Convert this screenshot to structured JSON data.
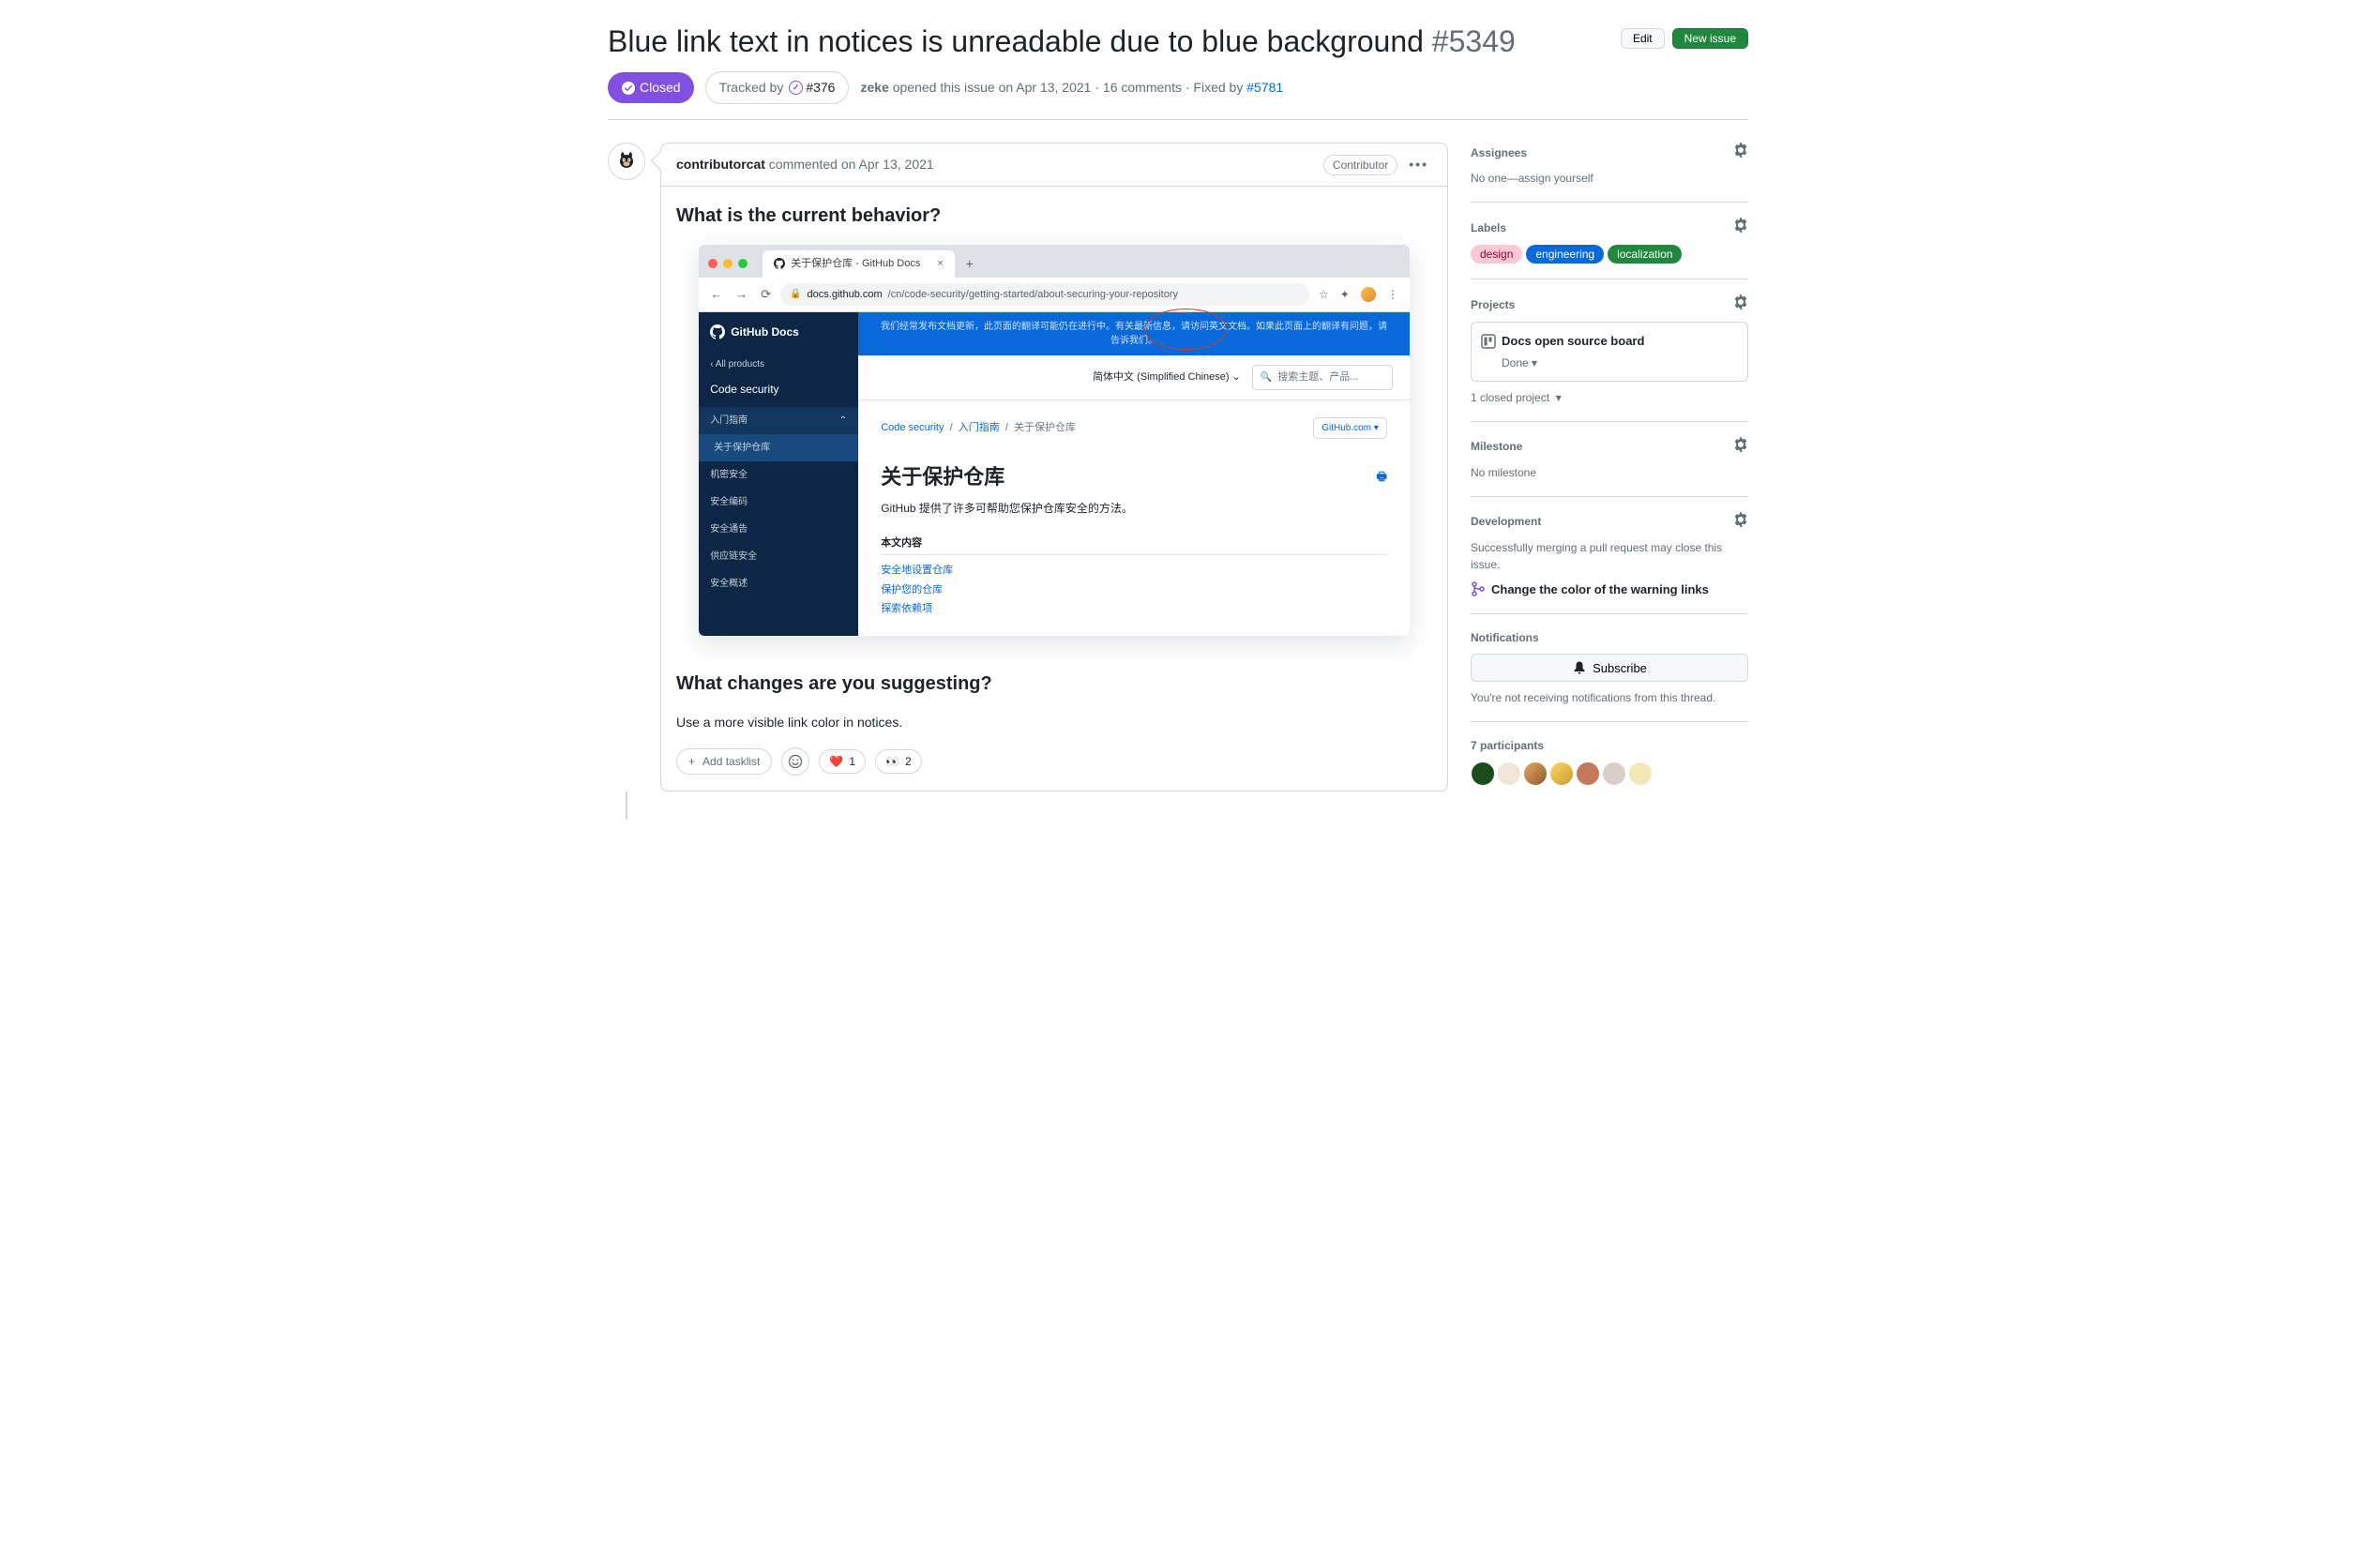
{
  "header": {
    "title": "Blue link text in notices is unreadable due to blue background",
    "issue_number": "#5349",
    "edit_label": "Edit",
    "new_issue_label": "New issue",
    "state_label": "Closed",
    "tracked_by_label": "Tracked by",
    "tracked_ref": "#376",
    "author": "zeke",
    "opened_text": " opened this issue ",
    "opened_date": "on Apr 13, 2021",
    "comments_sep": " · ",
    "comments_count": "16 comments",
    "fixed_by_sep": " · Fixed by ",
    "fixed_by_ref": "#5781"
  },
  "comment": {
    "author": "contributorcat",
    "commented_text": " commented ",
    "date": "on Apr 13, 2021",
    "badge": "Contributor",
    "h3_1": "What is the current behavior?",
    "h3_2": "What changes are you suggesting?",
    "body_2": "Use a more visible link color in notices.",
    "tasklist_label": "Add tasklist",
    "reactions": [
      {
        "emoji": "❤️",
        "count": "1"
      },
      {
        "emoji": "👀",
        "count": "2"
      }
    ]
  },
  "screenshot": {
    "tab_title": "关于保护仓库 - GitHub Docs",
    "url_domain": "docs.github.com",
    "url_path": "/cn/code-security/getting-started/about-securing-your-repository",
    "brand": "GitHub Docs",
    "back_all": "All products",
    "section": "Code security",
    "nav_items": [
      "入门指南",
      "关于保护仓库",
      "机密安全",
      "安全编码",
      "安全通告",
      "供应链安全",
      "安全概述"
    ],
    "banner": "我们经常发布文档更新，此页面的翻译可能仍在进行中。有关最新信息，请访问英文文档。如果此页面上的翻译有问题，请告诉我们。",
    "lang": "简体中文 (Simplified Chinese)",
    "search_placeholder": "搜索主题、产品...",
    "crumb_1": "Code security",
    "crumb_2": "入门指南",
    "crumb_3": "关于保护仓库",
    "gh_com": "GitHub.com",
    "page_title": "关于保护仓库",
    "page_desc": "GitHub 提供了许多可帮助您保护仓库安全的方法。",
    "toc_title": "本文内容",
    "toc": [
      "安全地设置仓库",
      "保护您的仓库",
      "探索依赖项"
    ]
  },
  "sidebar": {
    "assignees_title": "Assignees",
    "assignees_text": "No one—",
    "assignees_link": "assign yourself",
    "labels_title": "Labels",
    "labels": [
      {
        "name": "design",
        "bg": "#ffc8d3",
        "fg": "#92002e"
      },
      {
        "name": "engineering",
        "bg": "#0969da",
        "fg": "#ffffff"
      },
      {
        "name": "localization",
        "bg": "#1f883d",
        "fg": "#ffffff"
      }
    ],
    "projects_title": "Projects",
    "project_name": "Docs open source board",
    "project_status": "Done",
    "closed_projects": "1 closed project",
    "milestone_title": "Milestone",
    "milestone_text": "No milestone",
    "development_title": "Development",
    "development_text": "Successfully merging a pull request may close this issue.",
    "development_link": "Change the color of the warning links",
    "notifications_title": "Notifications",
    "subscribe_label": "Subscribe",
    "notifications_text": "You're not receiving notifications from this thread.",
    "participants_title": "7 participants"
  }
}
